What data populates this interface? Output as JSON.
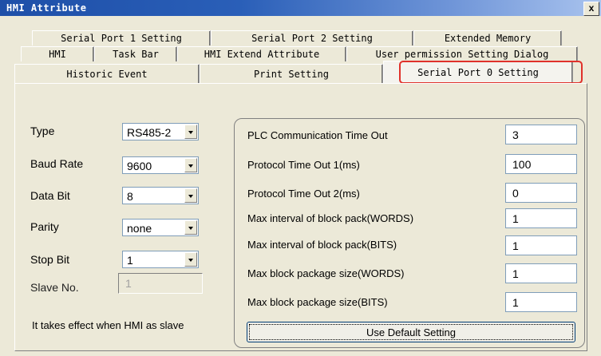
{
  "window": {
    "title": "HMI Attribute",
    "close": "x"
  },
  "tabs": {
    "row1": [
      "Serial Port 1 Setting",
      "Serial Port 2 Setting",
      "Extended Memory"
    ],
    "row2": [
      "HMI",
      "Task Bar",
      "HMI Extend Attribute",
      "User permission Setting Dialog"
    ],
    "row3": [
      "Historic Event",
      "Print Setting",
      "Serial Port 0 Setting"
    ],
    "active": "Serial Port 0 Setting"
  },
  "left": {
    "type": {
      "label": "Type",
      "value": "RS485-2"
    },
    "baud": {
      "label": "Baud Rate",
      "value": "9600"
    },
    "databit": {
      "label": "Data Bit",
      "value": "8"
    },
    "parity": {
      "label": "Parity",
      "value": "none"
    },
    "stopbit": {
      "label": "Stop Bit",
      "value": "1"
    },
    "slave": {
      "label": "Slave No.",
      "value": "1"
    },
    "note": "It takes effect when HMI as slave"
  },
  "params": [
    {
      "label": "PLC Communication Time Out",
      "value": "3"
    },
    {
      "label": "Protocol Time Out 1(ms)",
      "value": "100"
    },
    {
      "label": "Protocol Time Out 2(ms)",
      "value": "0"
    },
    {
      "label": "Max interval of block pack(WORDS)",
      "value": "1"
    },
    {
      "label": "Max interval of block pack(BITS)",
      "value": "1"
    },
    {
      "label": "Max block package size(WORDS)",
      "value": "1"
    },
    {
      "label": "Max block package size(BITS)",
      "value": "1"
    }
  ],
  "default_button": "Use Default Setting",
  "colors": {
    "highlight": "#e0312b",
    "titlebar": "#1e4fa8"
  }
}
